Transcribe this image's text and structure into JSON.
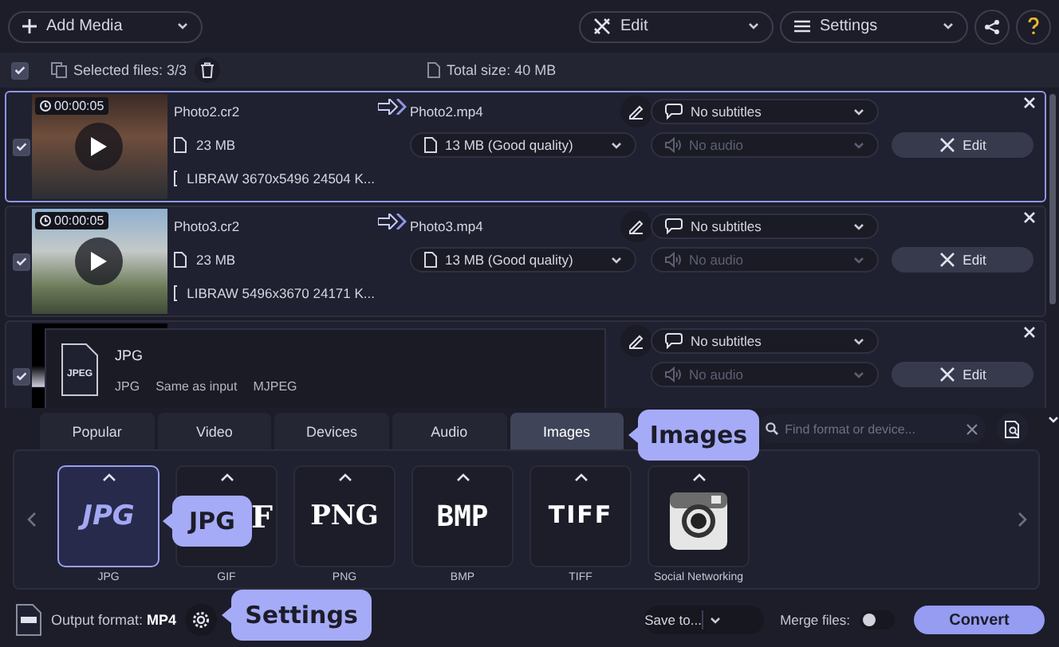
{
  "toolbar": {
    "add_media": "Add Media",
    "edit": "Edit",
    "settings": "Settings"
  },
  "selection_bar": {
    "checked": true,
    "selected_files": "Selected files: 3/3",
    "total_size": "Total size: 40 MB"
  },
  "files": [
    {
      "checked": true,
      "selected": true,
      "time": "00:00:05",
      "name": "Photo2.cr2",
      "size": "23 MB",
      "codec": "LIBRAW 3670x5496 24504 K...",
      "output_name": "Photo2.mp4",
      "quality": "13 MB (Good quality)",
      "subtitles": "No subtitles",
      "audio": "No audio",
      "audio_disabled": true,
      "edit": "Edit"
    },
    {
      "checked": true,
      "selected": false,
      "time": "00:00:05",
      "name": "Photo3.cr2",
      "size": "23 MB",
      "codec": "LIBRAW 5496x3670 24171 K...",
      "output_name": "Photo3.mp4",
      "quality": "13 MB (Good quality)",
      "subtitles": "No subtitles",
      "audio": "No audio",
      "audio_disabled": true,
      "edit": "Edit"
    },
    {
      "checked": true,
      "selected": false,
      "subtitles": "No subtitles",
      "audio": "No audio",
      "audio_disabled": true,
      "edit": "Edit"
    }
  ],
  "format_popup": {
    "icon_text": "JPEG",
    "title": "JPG",
    "details": [
      "JPG",
      "Same as input",
      "MJPEG"
    ]
  },
  "tabs": [
    {
      "label": "Popular",
      "selected": false
    },
    {
      "label": "Video",
      "selected": false
    },
    {
      "label": "Devices",
      "selected": false
    },
    {
      "label": "Audio",
      "selected": false
    },
    {
      "label": "Images",
      "selected": true
    }
  ],
  "search": {
    "placeholder": "Find format or device..."
  },
  "formats": [
    {
      "kind": "logo",
      "logo": "JPG",
      "label": "JPG",
      "selected": true
    },
    {
      "kind": "logo",
      "logo": "F",
      "label": "GIF",
      "selected": false
    },
    {
      "kind": "logo",
      "logo": "PNG",
      "label": "PNG",
      "selected": false
    },
    {
      "kind": "logo",
      "logo": "BMP",
      "label": "BMP",
      "selected": false
    },
    {
      "kind": "logo",
      "logo": "TIFF",
      "label": "TIFF",
      "selected": false
    },
    {
      "kind": "camera",
      "label": "Social Networking",
      "selected": false
    }
  ],
  "bottom_bar": {
    "output_format": "Output format: **MP4**",
    "save_to": "Save to...",
    "merge_files": "Merge files:",
    "merge_on": false,
    "convert": "Convert"
  },
  "callouts": [
    "Images",
    "JPG",
    "Settings"
  ]
}
